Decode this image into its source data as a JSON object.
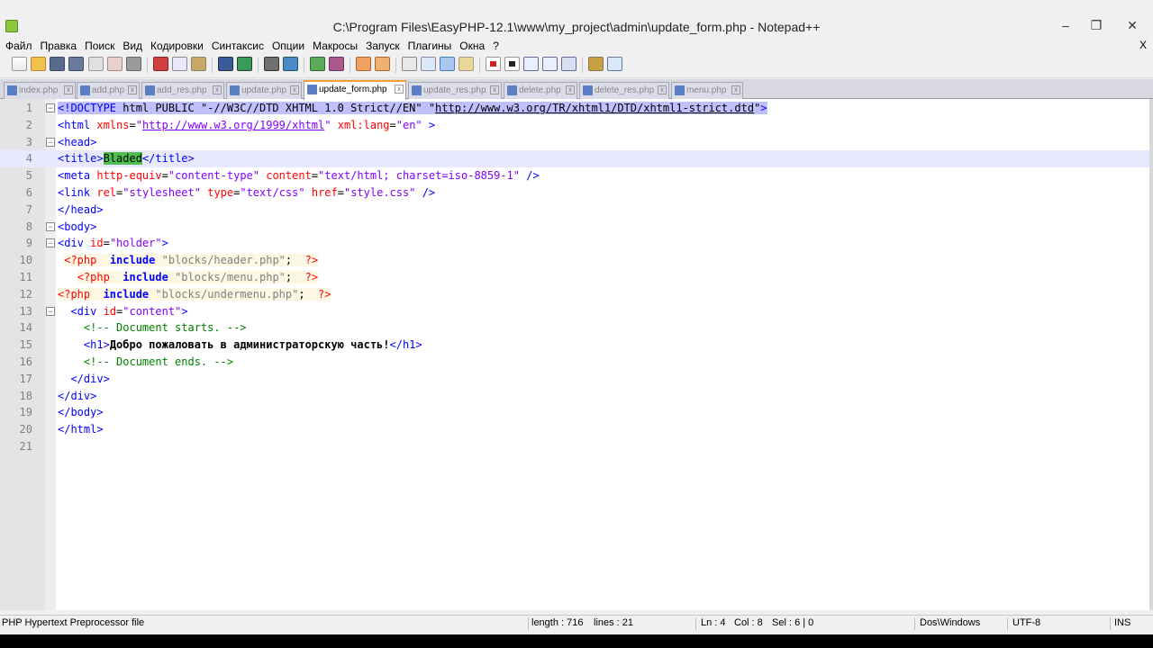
{
  "window": {
    "title": "C:\\Program Files\\EasyPHP-12.1\\www\\my_project\\admin\\update_form.php - Notepad++",
    "minimize": "–",
    "restore": "❐",
    "close": "✕"
  },
  "menu": {
    "items": [
      "Файл",
      "Правка",
      "Поиск",
      "Вид",
      "Кодировки",
      "Синтаксис",
      "Опции",
      "Макросы",
      "Запуск",
      "Плагины",
      "Окна",
      "?"
    ],
    "close_doc": "X"
  },
  "toolbar": {
    "icons": [
      "new-file",
      "open-file",
      "save",
      "save-all",
      "close",
      "close-all",
      "print",
      "cut",
      "copy",
      "paste",
      "undo",
      "redo",
      "find",
      "replace",
      "zoom-in",
      "zoom-out",
      "sync-v",
      "sync-h",
      "wrap",
      "all-chars",
      "indent-guide",
      "user-lang",
      "record",
      "stop",
      "play",
      "play-multi",
      "save-macro",
      "launch",
      "spellcheck"
    ]
  },
  "tabs": [
    {
      "label": "index.php",
      "active": false
    },
    {
      "label": "add.php",
      "active": false
    },
    {
      "label": "add_res.php",
      "active": false
    },
    {
      "label": "update.php",
      "active": false
    },
    {
      "label": "update_form.php",
      "active": true
    },
    {
      "label": "update_res.php",
      "active": false
    },
    {
      "label": "delete.php",
      "active": false
    },
    {
      "label": "delete_res.php",
      "active": false
    },
    {
      "label": "menu.php",
      "active": false
    }
  ],
  "editor": {
    "current_line": 4,
    "line_numbers": [
      "1",
      "2",
      "3",
      "4",
      "5",
      "6",
      "7",
      "8",
      "9",
      "10",
      "11",
      "12",
      "13",
      "14",
      "15",
      "16",
      "17",
      "18",
      "19",
      "20",
      "21"
    ],
    "lines": [
      "<!DOCTYPE html PUBLIC \"-//W3C//DTD XHTML 1.0 Strict//EN\" \"http://www.w3.org/TR/xhtml1/DTD/xhtml1-strict.dtd\">",
      "<html xmlns=\"http://www.w3.org/1999/xhtml\" xml:lang=\"en\" >",
      "<head>",
      "<title>Bladed</title>",
      "<meta http-equiv=\"content-type\" content=\"text/html; charset=iso-8859-1\" />",
      "<link rel=\"stylesheet\" type=\"text/css\" href=\"style.css\" />",
      "</head>",
      "<body>",
      "<div id=\"holder\">",
      " <?php  include \"blocks/header.php\";  ?>",
      "   <?php  include \"blocks/menu.php\";  ?>",
      "<?php  include \"blocks/undermenu.php\";  ?>",
      "  <div id=\"content\">",
      "    <!-- Document starts. -->",
      "    <h1>Добро пожаловать в администраторскую часть!</h1>",
      "    <!-- Document ends. -->",
      "  </div>",
      "</div>",
      "</body>",
      "</html>",
      ""
    ]
  },
  "status": {
    "file_type": "PHP Hypertext Preprocessor file",
    "length": "length : 716",
    "lines": "lines : 21",
    "ln": "Ln : 4",
    "col": "Col : 8",
    "sel": "Sel : 6 | 0",
    "eol": "Dos\\Windows",
    "encoding": "UTF-8",
    "mode": "INS"
  },
  "colors": {
    "tag": "#0000ff",
    "attribute": "#ff0000",
    "value": "#8000ff",
    "comment": "#008000",
    "active_tab_accent": "#f8a030",
    "current_line": "#e8e8ff",
    "match_highlight": "#4ec04e"
  }
}
